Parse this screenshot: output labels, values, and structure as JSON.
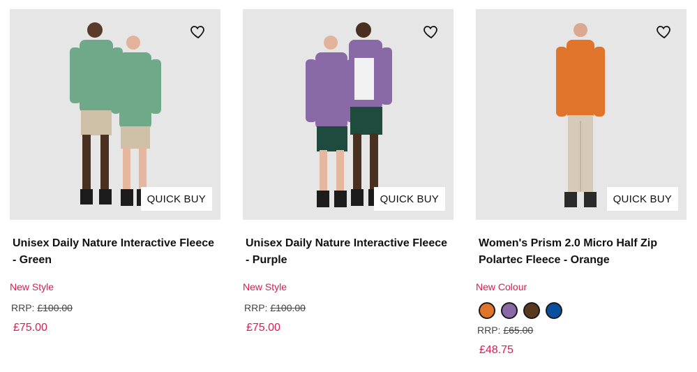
{
  "products": [
    {
      "title": "Unisex Daily Nature Interactive Fleece - Green",
      "tag": "New Style",
      "rrp_label": "RRP:",
      "rrp_value": "£100.00",
      "price": "£75.00",
      "quick_buy": "QUICK BUY",
      "image_alt": "Two models wearing green fleece jackets and shorts",
      "colors": {
        "jacket": "#6fa98a",
        "bottom": "#cfc0a8"
      }
    },
    {
      "title": "Unisex Daily Nature Interactive Fleece - Purple",
      "tag": "New Style",
      "rrp_label": "RRP:",
      "rrp_value": "£100.00",
      "price": "£75.00",
      "quick_buy": "QUICK BUY",
      "image_alt": "Two models wearing purple fleece jackets and green shorts",
      "colors": {
        "jacket": "#8a6aa6",
        "bottom": "#1f4a3e"
      }
    },
    {
      "title": "Women's Prism 2.0 Micro Half Zip Polartec Fleece - Orange",
      "tag": "New Colour",
      "swatches": [
        {
          "name": "orange",
          "color": "#e0742b"
        },
        {
          "name": "purple",
          "color": "#8a6aa6"
        },
        {
          "name": "brown",
          "color": "#5a3a1e"
        },
        {
          "name": "blue",
          "color": "#0a4f9e"
        }
      ],
      "rrp_label": "RRP:",
      "rrp_value": "£65.00",
      "price": "£48.75",
      "quick_buy": "QUICK BUY",
      "image_alt": "Model wearing an orange half zip fleece and beige trousers",
      "colors": {
        "jacket": "#e0742b",
        "bottom": "#d6cbb8"
      }
    }
  ],
  "icons": {
    "wishlist": "heart-outline-icon"
  }
}
